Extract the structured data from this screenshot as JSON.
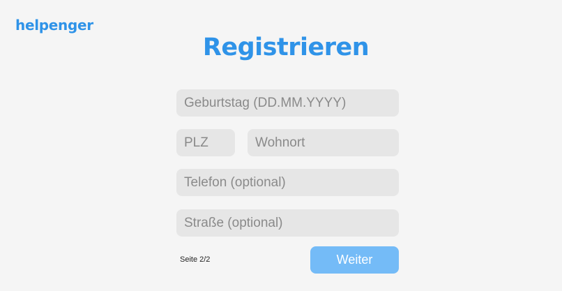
{
  "brand": {
    "logo_text": "helpenger"
  },
  "page": {
    "title": "Registrieren"
  },
  "form": {
    "birthday": {
      "value": "",
      "placeholder": "Geburtstag (DD.MM.YYYY)"
    },
    "zip": {
      "value": "",
      "placeholder": "PLZ"
    },
    "city": {
      "value": "",
      "placeholder": "Wohnort"
    },
    "phone": {
      "value": "",
      "placeholder": "Telefon (optional)"
    },
    "street": {
      "value": "",
      "placeholder": "Straße (optional)"
    }
  },
  "footer": {
    "page_indicator": "Seite 2/2",
    "next_label": "Weiter"
  },
  "colors": {
    "brand_blue": "#2f93e8",
    "button_blue": "#74bbf7",
    "field_bg": "#e6e6e6",
    "page_bg": "#f5f5f5"
  }
}
